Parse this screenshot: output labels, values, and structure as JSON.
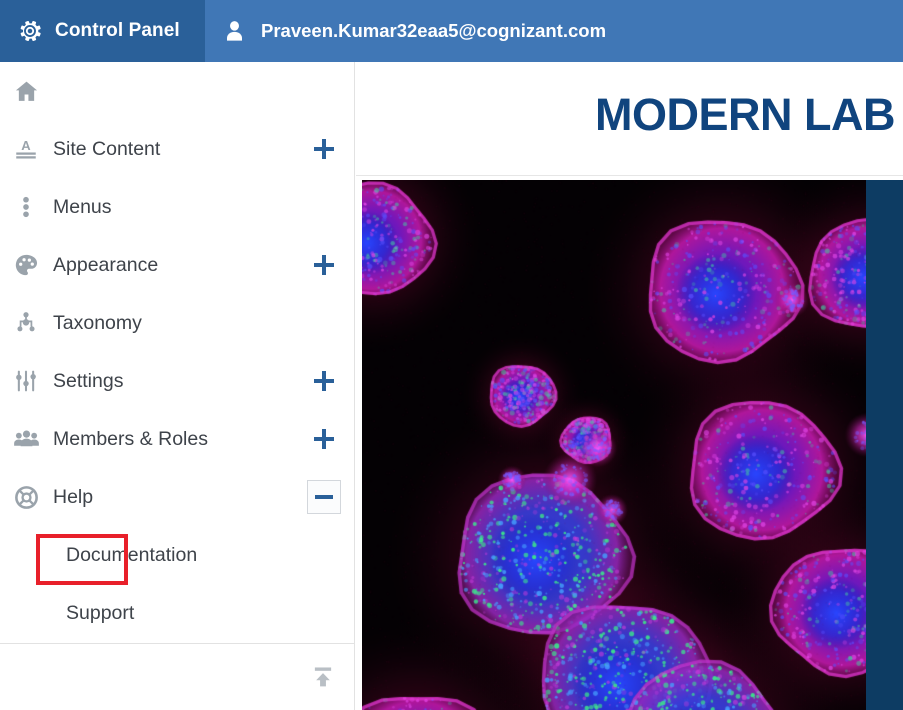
{
  "topbar": {
    "control_panel_label": "Control Panel",
    "control_panel_icon": "gear-icon",
    "user_icon": "user-avatar-icon",
    "user_email": "Praveen.Kumar32eaa5@cognizant.com",
    "dark_blue": "#2a6099",
    "light_blue": "#4077b6"
  },
  "sidebar": {
    "items": [
      {
        "label": "",
        "icon": "home-icon",
        "toggle": "none"
      },
      {
        "label": "Site Content",
        "icon": "text-document-icon",
        "toggle": "plus"
      },
      {
        "label": "Menus",
        "icon": "menu-dots-icon",
        "toggle": "none"
      },
      {
        "label": "Appearance",
        "icon": "palette-icon",
        "toggle": "plus"
      },
      {
        "label": "Taxonomy",
        "icon": "hierarchy-icon",
        "toggle": "none"
      },
      {
        "label": "Settings",
        "icon": "sliders-icon",
        "toggle": "plus"
      },
      {
        "label": "Members & Roles",
        "icon": "people-group-icon",
        "toggle": "plus"
      },
      {
        "label": "Help",
        "icon": "lifebuoy-icon",
        "toggle": "minus"
      }
    ],
    "sub_items": [
      {
        "label": "Documentation"
      },
      {
        "label": "Support"
      }
    ],
    "highlighted_item": "Help",
    "highlight_color": "#e8202a",
    "toggle_color": "#2a6099",
    "footer_icon": "collapse-up-icon"
  },
  "content": {
    "site_title": "MODERN LAB",
    "title_color": "#10447e",
    "hero_image": {
      "name": "fluorescence-microscopy-cells",
      "description": "Fluorescence microscopy image of cells with blue nuclei, magenta membranes and green puncta on a black background",
      "background": "#040104",
      "accent_colors": [
        "#2a1fd0",
        "#c81ec8",
        "#22d07a",
        "#1f3fe0"
      ]
    },
    "right_band_color": "#0d3c63"
  }
}
